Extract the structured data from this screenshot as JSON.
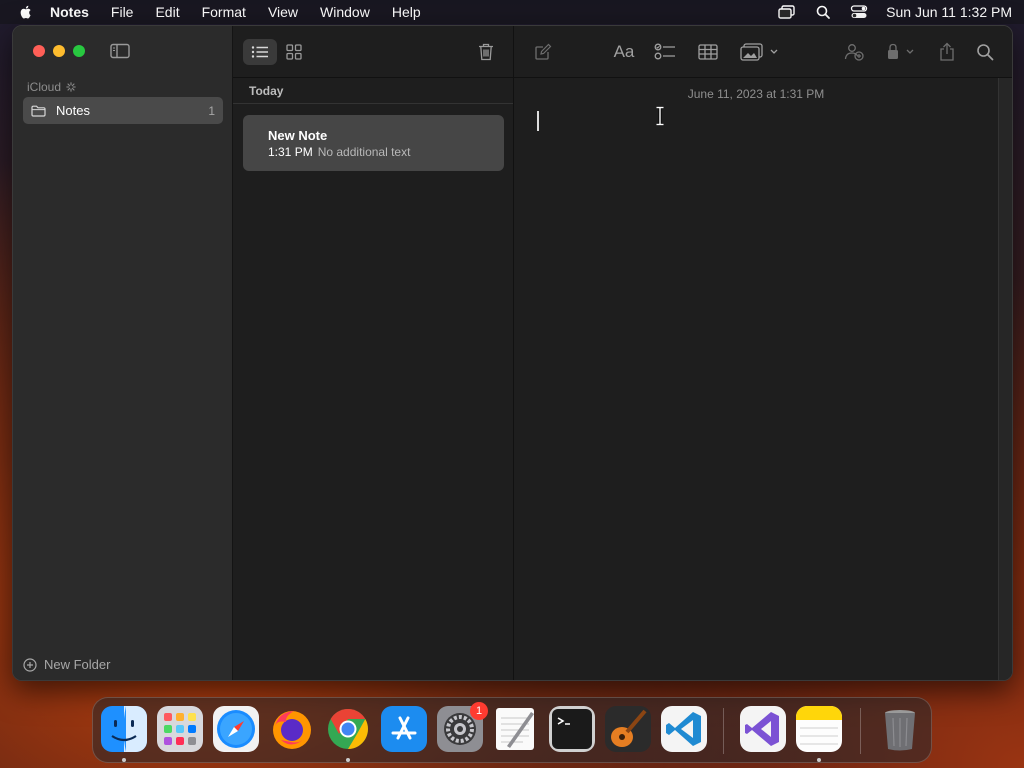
{
  "menubar": {
    "app_name": "Notes",
    "items": [
      "File",
      "Edit",
      "Format",
      "View",
      "Window",
      "Help"
    ],
    "datetime": "Sun Jun 11  1:32 PM"
  },
  "sidebar": {
    "account": "iCloud",
    "folders": [
      {
        "name": "Notes",
        "count": "1"
      }
    ],
    "new_folder_label": "New Folder"
  },
  "note_list": {
    "section": "Today",
    "notes": [
      {
        "title": "New Note",
        "time": "1:31 PM",
        "preview": "No additional text"
      }
    ]
  },
  "editor": {
    "date": "June 11, 2023 at 1:31 PM",
    "format_label": "Aa"
  },
  "dock": {
    "apps": [
      "Finder",
      "Launchpad",
      "Safari",
      "Firefox",
      "Chrome",
      "App Store",
      "System Settings",
      "TextEdit",
      "Terminal",
      "GarageBand",
      "VS Code",
      "Visual Studio",
      "Notes",
      "Trash"
    ],
    "settings_badge": "1"
  },
  "colors": {
    "accent_close": "#ff5f57",
    "accent_min": "#febc2e",
    "accent_max": "#28c840",
    "selection": "#4a4a4a",
    "note_card": "#464646"
  }
}
